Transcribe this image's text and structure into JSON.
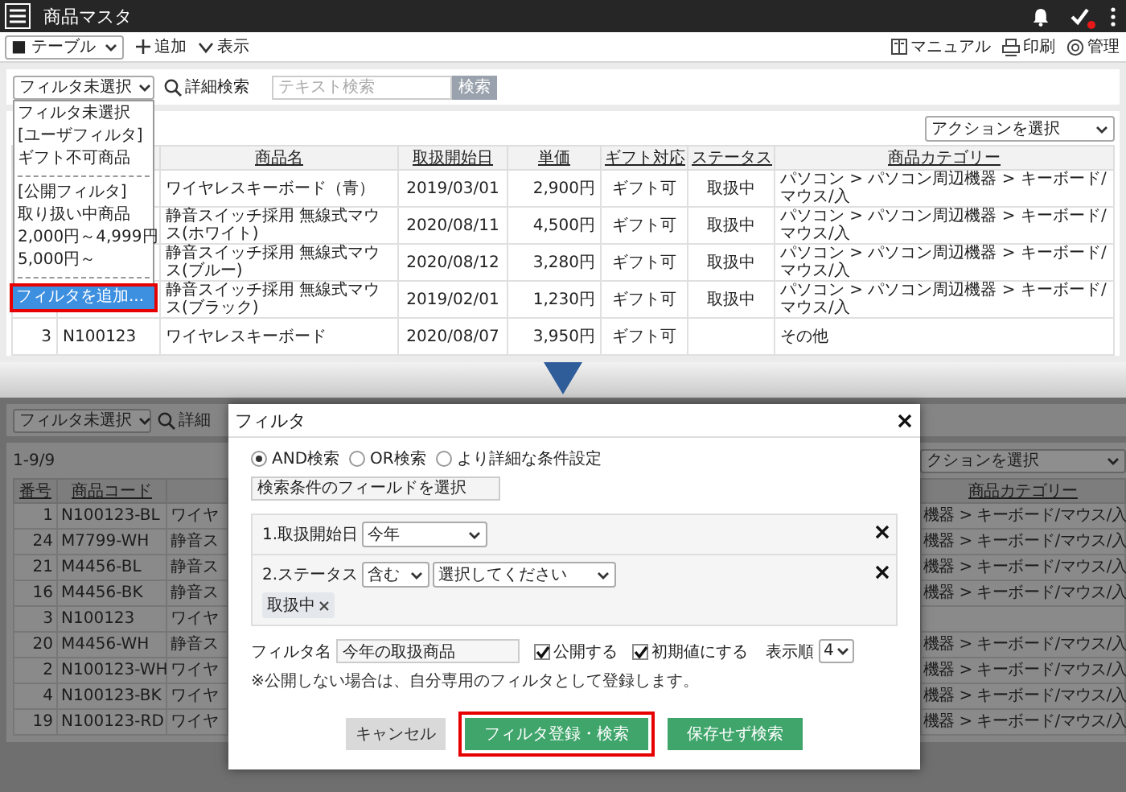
{
  "header": {
    "title": "商品マスタ",
    "check_badge": true
  },
  "toolbar": {
    "view_select": "■ テーブル",
    "add": "追加",
    "display": "表示",
    "links": [
      {
        "kind": "manual",
        "label": "マニュアル"
      },
      {
        "kind": "print",
        "label": "印刷"
      },
      {
        "kind": "admin",
        "label": "管理"
      }
    ]
  },
  "filter_bar": {
    "filter_select": "フィルタ未選択",
    "advanced_search": "詳細検索",
    "search_placeholder": "テキスト検索",
    "search_button": "検索"
  },
  "filter_dropdown": {
    "items": [
      {
        "kind": "option",
        "label": "フィルタ未選択",
        "selected": false,
        "highlighted": false
      },
      {
        "kind": "group",
        "label": "[ユーザフィルタ]"
      },
      {
        "kind": "option",
        "label": "ギフト不可商品",
        "selected": false,
        "highlighted": false
      },
      {
        "kind": "separator"
      },
      {
        "kind": "group",
        "label": "[公開フィルタ]"
      },
      {
        "kind": "option",
        "label": "取り扱い中商品",
        "selected": false,
        "highlighted": false
      },
      {
        "kind": "option",
        "label": "2,000円～4,999円",
        "selected": false,
        "highlighted": false
      },
      {
        "kind": "option",
        "label": "5,000円～",
        "selected": false,
        "highlighted": false
      },
      {
        "kind": "separator"
      },
      {
        "kind": "option",
        "label": "フィルタを追加...",
        "selected": true,
        "highlighted": true
      }
    ]
  },
  "action_select": "アクションを選択",
  "table": {
    "columns": [
      "商品名",
      "取扱開始日",
      "単価",
      "ギフト対応",
      "ステータス",
      "商品カテゴリー"
    ],
    "rows": [
      {
        "cells": [
          "ワイヤレスキーボード（青）",
          "2019/03/01",
          "2,900円",
          "ギフト可",
          "取扱中",
          "パソコン > パソコン周辺機器 > キーボード/マウス/入"
        ]
      },
      {
        "cells": [
          "静音スイッチ採用 無線式マウス(ホワイト)",
          "2020/08/11",
          "4,500円",
          "ギフト可",
          "取扱中",
          "パソコン > パソコン周辺機器 > キーボード/マウス/入"
        ]
      },
      {
        "cells": [
          "静音スイッチ採用 無線式マウス(ブルー)",
          "2020/08/12",
          "3,280円",
          "ギフト可",
          "取扱中",
          "パソコン > パソコン周辺機器 > キーボード/マウス/入"
        ]
      },
      {
        "cells": [
          "静音スイッチ採用 無線式マウス(ブラック)",
          "2019/02/01",
          "1,230円",
          "ギフト可",
          "取扱中",
          "パソコン > パソコン周辺機器 > キーボード/マウス/入"
        ]
      },
      {
        "number": "3",
        "code": "N100123",
        "cells": [
          "ワイヤレスキーボード",
          "2020/08/07",
          "3,950円",
          "ギフト可",
          null,
          "その他"
        ]
      }
    ]
  },
  "dimmed_page": {
    "filter_select": "フィルタ未選択",
    "advanced_search": "詳細",
    "count": "1-9/9",
    "action_select": "クションを選択",
    "columns": [
      "番号",
      "商品コード"
    ],
    "category_column": "商品カテゴリー",
    "rows": [
      {
        "number": "1",
        "code": "N100123-BL",
        "name": "ワイヤ",
        "category": "機器 > キーボード/マウス/入"
      },
      {
        "number": "24",
        "code": "M7799-WH",
        "name": "静音ス",
        "category": "機器 > キーボード/マウス/入"
      },
      {
        "number": "21",
        "code": "M4456-BL",
        "name": "静音ス",
        "category": "機器 > キーボード/マウス/入"
      },
      {
        "number": "16",
        "code": "M4456-BK",
        "name": "静音ス",
        "category": "機器 > キーボード/マウス/入"
      },
      {
        "number": "3",
        "code": "N100123",
        "name": "ワイヤ"
      },
      {
        "number": "20",
        "code": "M4456-WH",
        "name": "静音ス",
        "category": "機器 > キーボード/マウス/入"
      },
      {
        "number": "2",
        "code": "N100123-WH",
        "name": "ワイヤ",
        "category": "機器 > キーボード/マウス/入"
      },
      {
        "number": "4",
        "code": "N100123-BK",
        "name": "ワイヤ",
        "category": "機器 > キーボード/マウス/入"
      },
      {
        "number": "19",
        "code": "N100123-RD",
        "name": "ワイヤ",
        "category": "機器 > キーボード/マウス/入"
      }
    ]
  },
  "filter_dialog": {
    "title": "フィルタ",
    "logic": [
      {
        "label": "AND検索",
        "selected": true
      },
      {
        "label": "OR検索",
        "selected": false
      },
      {
        "label": "より詳細な条件設定",
        "selected": false
      }
    ],
    "field_select": "検索条件のフィールドを選択",
    "conditions": [
      {
        "label": "1.取扱開始日",
        "selects": [
          "今年"
        ]
      },
      {
        "label": "2.ステータス",
        "selects": [
          "含む",
          "選択してください"
        ],
        "tags": [
          "取扱中"
        ]
      }
    ],
    "name_label": "フィルタ名",
    "name_value": "今年の取扱商品",
    "options": [
      {
        "label": "公開する",
        "checked": true
      },
      {
        "label": "初期値にする",
        "checked": true
      }
    ],
    "order_label": "表示順",
    "order": "4",
    "note": "※公開しない場合は、自分専用のフィルタとして登録します。",
    "buttons": [
      {
        "kind": "cancel",
        "label": "キャンセル",
        "highlighted": false
      },
      {
        "kind": "primary",
        "label": "フィルタ登録・検索",
        "highlighted": true
      },
      {
        "kind": "primary",
        "label": "保存せず検索",
        "highlighted": false
      }
    ]
  }
}
